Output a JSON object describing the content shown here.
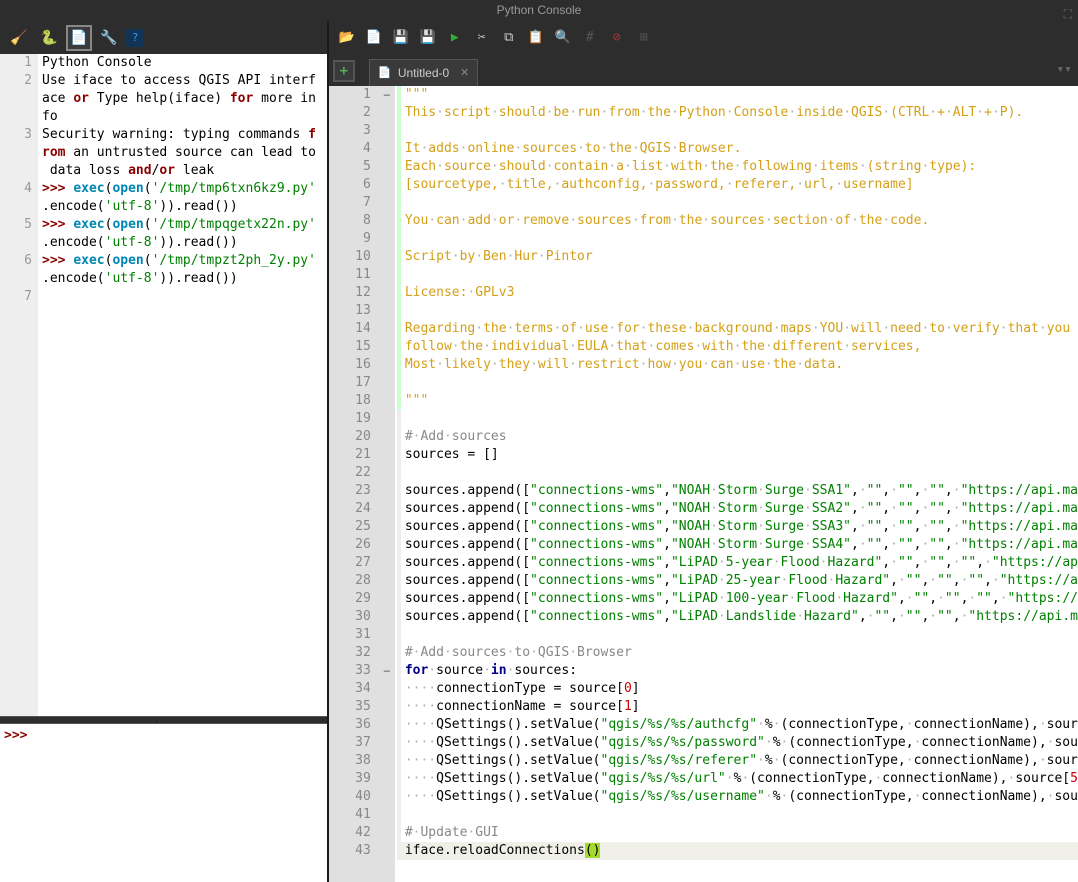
{
  "window": {
    "title": "Python Console"
  },
  "tab": {
    "label": "Untitled-0"
  },
  "console_input_prompt": ">>>",
  "console_lines": [
    {
      "n": "1",
      "h": 1
    },
    {
      "n": "2",
      "h": 2
    },
    {
      "n": " ",
      "h": 1
    },
    {
      "n": "3",
      "h": 3
    },
    {
      "n": " ",
      "h": 1
    },
    {
      "n": " ",
      "h": 1
    },
    {
      "n": "4",
      "h": 2
    },
    {
      "n": " ",
      "h": 1
    },
    {
      "n": "5",
      "h": 2
    },
    {
      "n": " ",
      "h": 1
    },
    {
      "n": "6",
      "h": 2
    },
    {
      "n": " ",
      "h": 1
    },
    {
      "n": "7",
      "h": 1
    }
  ],
  "editor_data": {
    "docstring": [
      "\"\"\"",
      "This script should be run from the Python Console inside QGIS (CTRL + ALT + P).",
      "",
      "It adds online sources to the QGIS Browser.",
      "Each source should contain a list with the following items (string type):",
      "[sourcetype, title, authconfig, password, referer, url, username]",
      "",
      "You can add or remove sources from the sources section of the code.",
      "",
      "Script by Ben Hur Pintor",
      "",
      "License: GPLv3",
      "",
      "Regarding the terms of use for these background maps YOU will need to verify that you",
      "follow the individual EULA that comes with the different services,",
      "Most likely they will restrict how you can use the data.",
      "",
      "\"\"\""
    ],
    "comment_add_sources": "# Add sources",
    "sources_init": "sources = []",
    "appends": [
      {
        "type": "connections-wms",
        "title": "NOAH Storm Surge SSA1",
        "url": "https://api.ma"
      },
      {
        "type": "connections-wms",
        "title": "NOAH Storm Surge SSA2",
        "url": "https://api.ma"
      },
      {
        "type": "connections-wms",
        "title": "NOAH Storm Surge SSA3",
        "url": "https://api.ma"
      },
      {
        "type": "connections-wms",
        "title": "NOAH Storm Surge SSA4",
        "url": "https://api.ma"
      },
      {
        "type": "connections-wms",
        "title": "LiPAD 5-year Flood Hazard",
        "url": "https://ap"
      },
      {
        "type": "connections-wms",
        "title": "LiPAD 25-year Flood Hazard",
        "url": "https://a"
      },
      {
        "type": "connections-wms",
        "title": "LiPAD 100-year Flood Hazard",
        "url": "https://"
      },
      {
        "type": "connections-wms",
        "title": "LiPAD Landslide Hazard",
        "url": "https://api.m"
      }
    ],
    "comment_add_to_browser": "# Add sources to QGIS Browser",
    "for_line": "for source in sources:",
    "body": [
      "connectionType = source[0]",
      "connectionName = source[1]",
      "QSettings().setValue(\"qgis/%s/%s/authcfg\" % (connectionType, connectionName), sour",
      "QSettings().setValue(\"qgis/%s/%s/password\" % (connectionType, connectionName), sou",
      "QSettings().setValue(\"qgis/%s/%s/referer\" % (connectionType, connectionName), sour",
      "QSettings().setValue(\"qgis/%s/%s/url\" % (connectionType, connectionName), source[5",
      "QSettings().setValue(\"qgis/%s/%s/username\" % (connectionType, connectionName), sou"
    ],
    "comment_update": "# Update GUI",
    "reload": "iface.reloadConnections()"
  }
}
